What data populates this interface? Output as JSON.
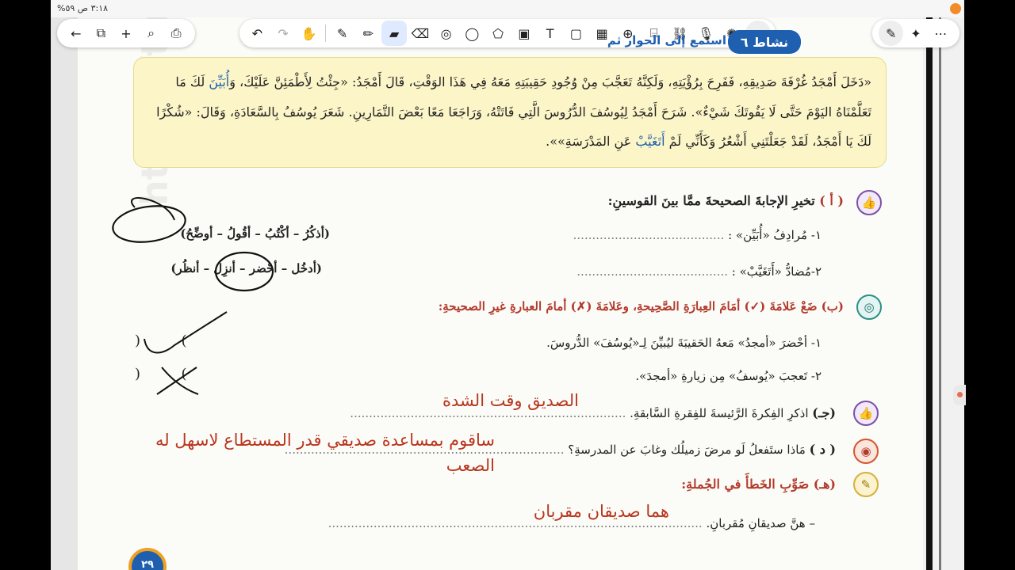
{
  "status_bar": {
    "time": "٣:١٨ ص",
    "battery": "٥٩%"
  },
  "toolbar_left": {
    "items": [
      {
        "name": "back-icon",
        "glyph": "←"
      },
      {
        "name": "pages-icon",
        "glyph": "⧉"
      },
      {
        "name": "add-icon",
        "glyph": "+"
      },
      {
        "name": "search-icon",
        "glyph": "⌕"
      },
      {
        "name": "share-icon",
        "glyph": "⎙"
      }
    ]
  },
  "toolbar_center": {
    "items": [
      {
        "name": "undo-icon",
        "glyph": "↶"
      },
      {
        "name": "redo-icon",
        "glyph": "↷"
      },
      {
        "name": "hand-icon",
        "glyph": "✋"
      },
      {
        "name": "pen-icon",
        "glyph": "✎"
      },
      {
        "name": "pencil-icon",
        "glyph": "✏"
      },
      {
        "name": "highlighter-icon",
        "glyph": "▰"
      },
      {
        "name": "eraser-icon",
        "glyph": "⌫"
      },
      {
        "name": "lasso-icon",
        "glyph": "◎"
      },
      {
        "name": "comment-icon",
        "glyph": "◯"
      },
      {
        "name": "shapes-icon",
        "glyph": "⬠"
      },
      {
        "name": "image-icon",
        "glyph": "▣"
      },
      {
        "name": "text-icon",
        "glyph": "T"
      },
      {
        "name": "sticky-note-icon",
        "glyph": "▢"
      },
      {
        "name": "table-icon",
        "glyph": "▦"
      },
      {
        "name": "zoom-icon",
        "glyph": "⊕"
      },
      {
        "name": "screenshot-icon",
        "glyph": "⌸"
      },
      {
        "name": "link-icon",
        "glyph": "⛓"
      },
      {
        "name": "microphone-icon",
        "glyph": "🎙"
      },
      {
        "name": "laser-icon",
        "glyph": "✺"
      },
      {
        "name": "collapse-icon",
        "glyph": "⌄"
      }
    ]
  },
  "toolbar_right": {
    "items": [
      {
        "name": "pen-off-icon",
        "glyph": "✎"
      },
      {
        "name": "ai-sparkle-icon",
        "glyph": "✦"
      },
      {
        "name": "more-icon",
        "glyph": "⋯"
      }
    ]
  },
  "worksheet": {
    "activity_badge": "نشاط ٦",
    "activity_title": "استمع إلى الحوار ثم أجب",
    "passage": {
      "part1": "«دَخَلَ أَمْجَدُ غُرْفَةَ صَدِيقِهِ، فَفَرِحَ بِرُؤْيَتِهِ، وَلَكِنَّهُ تَعَجَّبَ مِنْ وُجُودِ حَقِيبَتِهِ مَعَهُ فِي هَذَا الوَقْتِ، قَالَ أَمْجَدُ: «جِئْتُ لِأَطْمَئِنَّ عَلَيْكَ، وَ",
      "hl1": "أُبَيِّنَ",
      "part2": " لَكَ مَا تَعَلَّمْنَاهُ اليَوْمَ حَتَّى لَا يَفُوتَكَ شَيْءٌ». شَرَحَ أَمْجَدُ لِيُوسُفَ الدُّرُوسَ الَّتِي فَاتَتْهُ، وَرَاجَعَا مَعًا بَعْضَ التَّمَارِينِ. شَعَرَ يُوسُفُ بِالسَّعَادَةِ، وَقَالَ: «شُكْرًا لَكَ يَا أَمْجَدُ، لَقَدْ جَعَلْتَنِي أَشْعُرُ وَكَأَنِّي لَمْ ",
      "hl2": "أَتَغَيَّبْ",
      "part3": " عَنِ المَدْرَسَةِ»»."
    },
    "section_a": {
      "label": "( أ )",
      "heading": "تخيرِ الإجابةَ الصحيحةَ ممَّا بينَ القوسينِ:",
      "q1": "١- مُرادِفُ «أُبَيِّن» :",
      "q1_choices": "(أذكُرُ – أكْتُبُ – أقُولُ – أوضِّحُ)",
      "q2": "٢-مُضادُّ «أَتَغَيَّبْ» :",
      "q2_choices": "(أدخُل – أحْضر – أنزِل – أنظُر)",
      "dots": "........................................"
    },
    "section_b": {
      "label": "(ب)",
      "heading_pre": "ضَعْ عَلامَةَ (✓) أمَامَ العِبارَةِ الصَّحِيحةِ، وعَلامَةَ (✗) أمامَ العبارةِ غيرِ الصحيحةِ:",
      "s1": "١- أحْضرَ «أمجدُ» مَعهُ الحَقيبَةَ ليُبيِّنَ لِـ«يُوسُفَ» الدُّروسَ.",
      "s2": "٢- تَعجبَ «يُوسفُ» مِن زيارةِ «أمجدَ».",
      "paren_open": "(",
      "paren_close": ")"
    },
    "section_c": {
      "label": "(جـ)",
      "text": "اذكرِ الفِكرةَ الرَّئيسةَ للفِقرةِ السَّابقةِ.",
      "dots": ".........................................................................",
      "answer": "الصديق وقت الشدة"
    },
    "section_d": {
      "label": "( د )",
      "text": "مَاذا ستَفعلُ لَو مرضَ زميلُك وغابَ عن المدرسةِ؟",
      "dots": "..........................................................................",
      "answer_line1": "ساقوم بمساعدة صديقي قدر المستطاع لاسهل له",
      "answer_line2": "الصعب"
    },
    "section_e": {
      "label": "(هـ)",
      "heading": "صَوِّبِ الخَطأَ في الجُملةِ:",
      "sentence": "– هنَّ صديقانِ مُقربانِ.",
      "dots": "...................................................................................................",
      "answer": "هما صديقان مقربان"
    },
    "page_number": "٢٩",
    "watermark": "https://t.me/G5_Y5"
  }
}
